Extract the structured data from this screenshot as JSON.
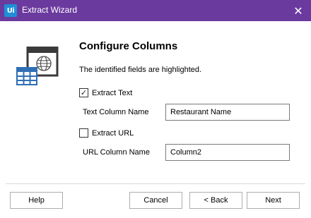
{
  "window": {
    "title": "Extract Wizard",
    "app_icon_text": "Ui",
    "close_glyph": "✕",
    "titlebar_color": "#6b3a9f"
  },
  "content": {
    "heading": "Configure Columns",
    "subtext": "The identified fields are highlighted.",
    "extract_text": {
      "label": "Extract Text",
      "checked": true,
      "check_glyph": "✓"
    },
    "text_column_name": {
      "label": "Text Column Name",
      "value": "Restaurant Name"
    },
    "extract_url": {
      "label": "Extract URL",
      "checked": false
    },
    "url_column_name": {
      "label": "URL Column Name",
      "value": "Column2"
    }
  },
  "buttons": {
    "help": "Help",
    "cancel": "Cancel",
    "back": "< Back",
    "next": "Next"
  },
  "icons": {
    "illustration": "web-page-table-extract-icon",
    "app": "uipath-app-icon",
    "close": "close-icon",
    "checkbox_checked": "checkmark-icon"
  }
}
